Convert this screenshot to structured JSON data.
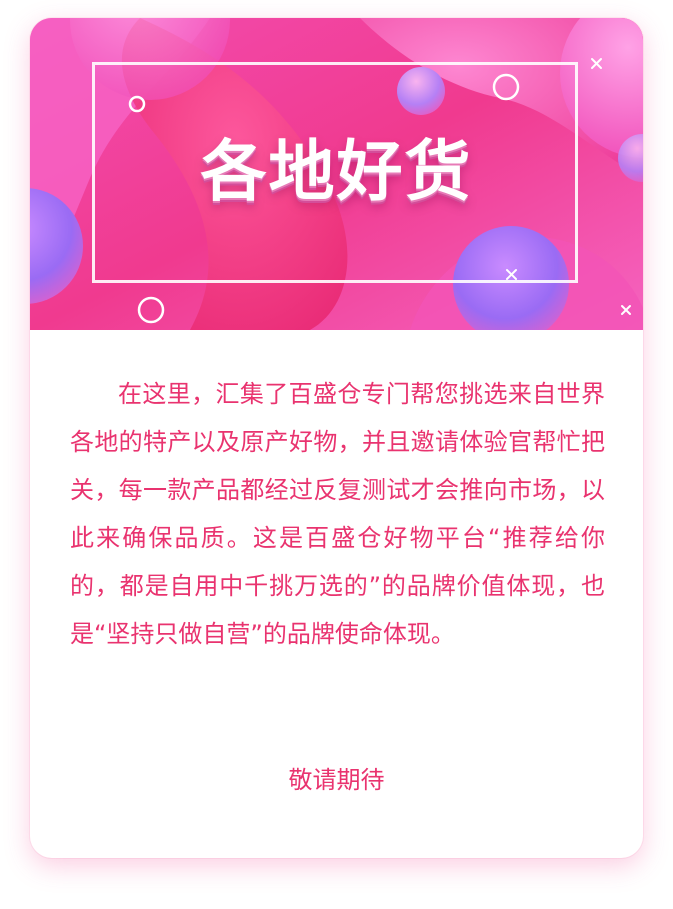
{
  "card": {
    "title": "各地好货",
    "description": "在这里，汇集了百盛仓专门帮您挑选来自世界各地的特产以及原产好物，并且邀请体验官帮忙把关，每一款产品都经过反复测试才会推向市场，以此来确保品质。这是百盛仓好物平台“推荐给你的，都是自用中千挑万选的”的品牌价值体现，也是“坚持只做自营”的品牌使命体现。",
    "footer": "敬请期待"
  },
  "colors": {
    "accent_text": "#e9336f",
    "banner_pink": "#f23f9c",
    "banner_magenta": "#e94db8"
  },
  "icons": [
    "ring-icon",
    "cross-icon"
  ]
}
